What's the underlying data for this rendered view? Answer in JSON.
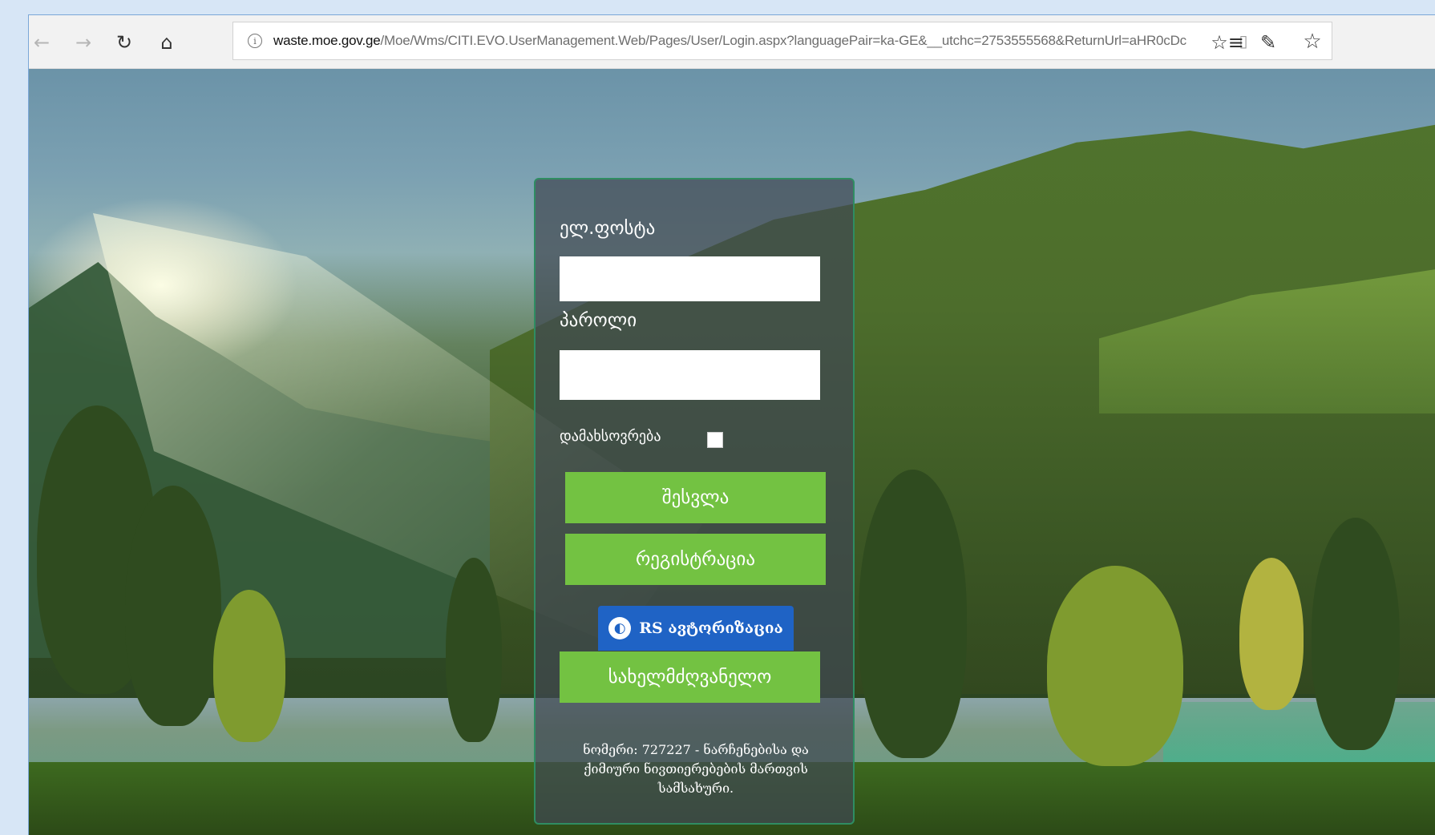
{
  "browser": {
    "url_host": "waste.moe.gov.ge",
    "url_path": "/Moe/Wms/CITI.EVO.UserManagement.Web/Pages/User/Login.aspx?languagePair=ka-GE&__utchc=2753555568&ReturnUrl=aHR0cDc",
    "nav_icons": {
      "back": "←",
      "forward": "→",
      "refresh": "↻",
      "home": "⌂"
    },
    "right_icons": {
      "favorites": "☆≡",
      "notes": "✎"
    }
  },
  "login": {
    "email_label": "ელ.ფოსტა",
    "email_value": "",
    "password_label": "პაროლი",
    "password_value": "",
    "remember_label": "დამახსოვრება",
    "submit_label": "შესვლა",
    "register_label": "რეგისტრაცია",
    "rs_label": "RS ავტორიზაცია",
    "manual_label": "სახელმძღვანელო",
    "footer_note": "ნომერი: 727227 - ნარჩენებისა და ქიმიური ნივთიერებების მართვის სამსახური."
  }
}
